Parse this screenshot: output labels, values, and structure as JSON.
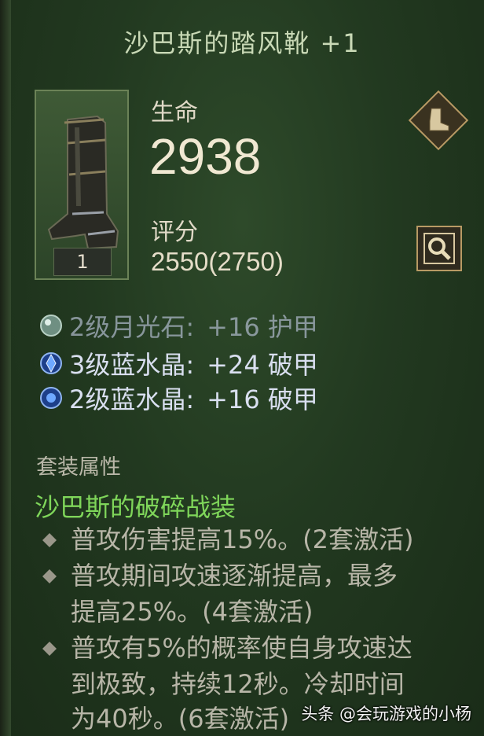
{
  "item": {
    "title": "沙巴斯的踏风靴 +1",
    "count": "1",
    "icon": "boots-icon"
  },
  "stats": {
    "life_label": "生命",
    "life_value": "2938",
    "score_label": "评分",
    "score_value": "2550(2750)"
  },
  "actions": {
    "equip_slot_icon": "boot-slot-icon",
    "inspect_icon": "magnifier-icon"
  },
  "gems": [
    {
      "name": "2级月光石:",
      "bonus": "+16 护甲",
      "icon": "moonstone-gem-icon",
      "color": "#9fb9a8"
    },
    {
      "name": "3级蓝水晶:",
      "bonus": "+24 破甲",
      "icon": "blue-crystal-gem-icon",
      "color": "#3f7fd9"
    },
    {
      "name": "2级蓝水晶:",
      "bonus": "+16 破甲",
      "icon": "blue-crystal-gem-icon",
      "color": "#3f7fd9"
    }
  ],
  "set": {
    "header": "套装属性",
    "name": "沙巴斯的破碎战装",
    "bonuses": [
      {
        "line1": "普攻伤害提高15%。(2套激活)"
      },
      {
        "line1": "普攻期间攻速逐渐提高，最多",
        "line2": "提高25%。(4套激活)"
      },
      {
        "line1": "普攻有5%的概率使自身攻速达",
        "line2": "到极致，持续12秒。冷却时间",
        "line3": "为40秒。(6套激活)"
      }
    ]
  },
  "watermark": "头条 @会玩游戏的小杨"
}
